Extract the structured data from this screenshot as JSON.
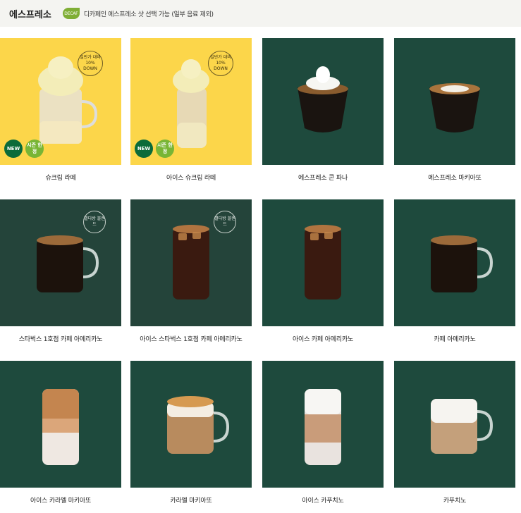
{
  "header": {
    "title": "에스프레소",
    "decaf_icon": "DECAF",
    "description": "디카페인 에스프레소 샷 선택 가능 (일부 음료 제외)"
  },
  "products": [
    {
      "name": "슈크림 라떼",
      "bg": "yellow",
      "badges": {
        "new": "NEW",
        "season": "시즌\n한정",
        "discount": "일반가 대비\n10%\nDOWN"
      }
    },
    {
      "name": "아이스 슈크림 라떼",
      "bg": "yellow",
      "badges": {
        "new": "NEW",
        "season": "시즌\n한정",
        "discount": "일반가 대비\n10%\nDOWN"
      }
    },
    {
      "name": "에스프레소 콘 파나",
      "bg": "green"
    },
    {
      "name": "에스프레소 마키아또",
      "bg": "green"
    },
    {
      "name": "스타벅스 1호점 카페 아메리카노",
      "bg": "deepgreen",
      "badges": {
        "blend": "별다방\n블렌드"
      }
    },
    {
      "name": "아이스 스타벅스 1호점 카페 아메리카노",
      "bg": "deepgreen",
      "badges": {
        "blend": "별다방\n블렌드"
      }
    },
    {
      "name": "아이스 카페 아메리카노",
      "bg": "green"
    },
    {
      "name": "카페 아메리카노",
      "bg": "green"
    },
    {
      "name": "아이스 카라멜 마키아또",
      "bg": "green"
    },
    {
      "name": "카라멜 마키아또",
      "bg": "green"
    },
    {
      "name": "아이스 카푸치노",
      "bg": "green"
    },
    {
      "name": "카푸치노",
      "bg": "green"
    }
  ]
}
